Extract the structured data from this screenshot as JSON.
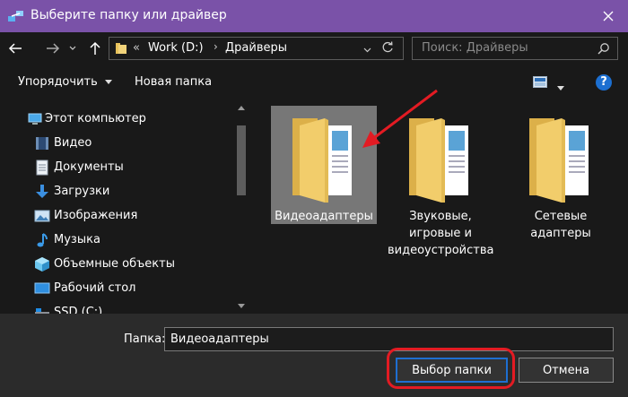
{
  "window": {
    "title": "Выберите папку или драйвер",
    "accent_color": "#7a52a8"
  },
  "address": {
    "prefix": "«",
    "crumbs": [
      "Work (D:)",
      "Драйверы"
    ],
    "search_placeholder": "Поиск: Драйверы"
  },
  "toolbar": {
    "organize": "Упорядочить",
    "new_folder": "Новая папка",
    "help": "?"
  },
  "nav": {
    "items": [
      {
        "label": "Этот компьютер",
        "icon": "computer-icon"
      },
      {
        "label": "Видео",
        "icon": "video-icon"
      },
      {
        "label": "Документы",
        "icon": "documents-icon"
      },
      {
        "label": "Загрузки",
        "icon": "downloads-icon"
      },
      {
        "label": "Изображения",
        "icon": "pictures-icon"
      },
      {
        "label": "Музыка",
        "icon": "music-icon"
      },
      {
        "label": "Объемные объекты",
        "icon": "3d-objects-icon"
      },
      {
        "label": "Рабочий стол",
        "icon": "desktop-icon"
      },
      {
        "label": "SSD (C:)",
        "icon": "drive-icon"
      }
    ]
  },
  "folders": [
    {
      "name": "Видеоадаптеры",
      "selected": true
    },
    {
      "name": "Звуковые, игровые и видеоустройства",
      "selected": false
    },
    {
      "name": "Сетевые адаптеры",
      "selected": false
    }
  ],
  "footer": {
    "folder_label": "Папка:",
    "folder_value": "Видеоадаптеры",
    "select_button": "Выбор папки",
    "cancel_button": "Отмена"
  },
  "annotation_color": "#e31b23"
}
